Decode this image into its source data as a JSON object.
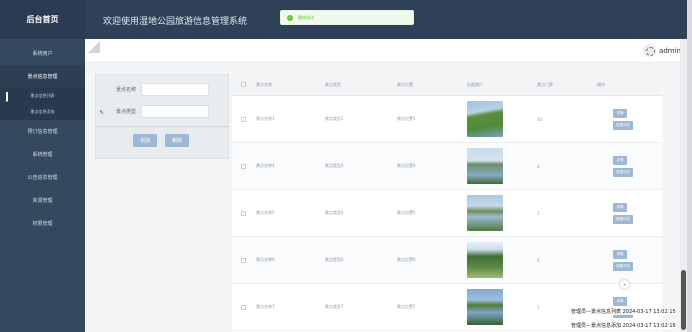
{
  "brand": "后台首页",
  "system_title": "欢迎使用湿地公园旅游信息管理系统",
  "toast": "删除成功",
  "user": {
    "name": "admin"
  },
  "sidebar": {
    "items": [
      {
        "label": "系统用户",
        "state": "normal"
      },
      {
        "label": "景点信息管理",
        "state": "active"
      },
      {
        "label": "景点信息列表",
        "state": "sub"
      },
      {
        "label": "景点信息添加",
        "state": "sub"
      },
      {
        "label": "预订信息管理",
        "state": "normal"
      },
      {
        "label": "系统管理",
        "state": "normal"
      },
      {
        "label": "公告信息管理",
        "state": "normal"
      },
      {
        "label": "资源管理",
        "state": "normal"
      },
      {
        "label": "权限管理",
        "state": "normal"
      }
    ]
  },
  "search": {
    "name_label": "景点名称",
    "type_label": "景点类型",
    "add_button": "添加",
    "delete_button": "删除"
  },
  "table": {
    "headers": [
      "景点名称",
      "景点类型",
      "景点位置",
      "封面图片",
      "景点门票",
      "操作"
    ],
    "rows": [
      {
        "name": "景点名称1",
        "type": "景点类型1",
        "location": "景点位置1",
        "price": "50",
        "image": "grass-path"
      },
      {
        "name": "景点名称4",
        "type": "景点类型4",
        "location": "景点位置4",
        "price": "4",
        "image": "lake-trees"
      },
      {
        "name": "景点名称5",
        "type": "景点类型5",
        "location": "景点位置5",
        "price": "5",
        "image": "coast"
      },
      {
        "name": "景点名称6",
        "type": "景点类型6",
        "location": "景点位置6",
        "price": "6",
        "image": "garden"
      },
      {
        "name": "景点名称7",
        "type": "景点类型7",
        "location": "景点位置7",
        "price": "7",
        "image": "reflection"
      }
    ],
    "op_detail": "详情",
    "op_comment": "查看评论"
  },
  "mini_badge": "×",
  "log": {
    "line1": "管理员—景点信息列表 2024-03-17 13:02:15",
    "line2": "管理员—景点信息添加 2024-03-17 13:02:16"
  },
  "colors": {
    "topbar": "#2e4159",
    "sidebar": "#34495e",
    "button": "#9fb7d6",
    "success": "#67c23a"
  }
}
